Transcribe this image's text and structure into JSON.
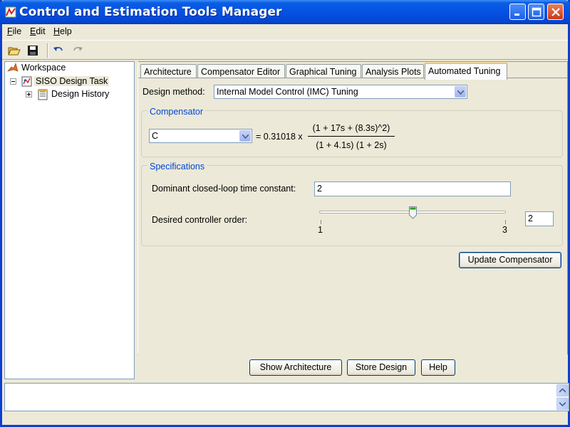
{
  "window": {
    "title": "Control and Estimation Tools Manager"
  },
  "menu": {
    "file": "File",
    "edit": "Edit",
    "help": "Help"
  },
  "toolbar": {
    "icons": [
      "open-folder-icon",
      "save-icon",
      "undo-icon",
      "redo-icon"
    ]
  },
  "tree": {
    "workspace": "Workspace",
    "task": "SISO Design Task",
    "history": "Design History"
  },
  "tabs": [
    {
      "label": "Architecture"
    },
    {
      "label": "Compensator Editor"
    },
    {
      "label": "Graphical Tuning"
    },
    {
      "label": "Analysis Plots"
    },
    {
      "label": "Automated Tuning",
      "active": true
    }
  ],
  "design_method": {
    "label": "Design method:",
    "value": "Internal Model Control (IMC) Tuning"
  },
  "compensator": {
    "title": "Compensator",
    "select_value": "C",
    "gain": "= 0.31018 x",
    "numerator": "(1 + 17s + (8.3s)^2)",
    "denominator": "(1 + 4.1s) (1 + 2s)"
  },
  "specifications": {
    "title": "Specifications",
    "time_constant_label": "Dominant closed-loop time constant:",
    "time_constant_value": "2",
    "order_label": "Desired controller order:",
    "slider_min": "1",
    "slider_max": "3",
    "order_value": "2",
    "slider_level": 0.5
  },
  "buttons": {
    "update": "Update Compensator",
    "show_architecture": "Show Architecture",
    "store_design": "Store Design",
    "help": "Help"
  },
  "colors": {
    "title_bar": "#0551e4",
    "group_title": "#0046d5",
    "active_tab_accent": "#ffc83c"
  }
}
